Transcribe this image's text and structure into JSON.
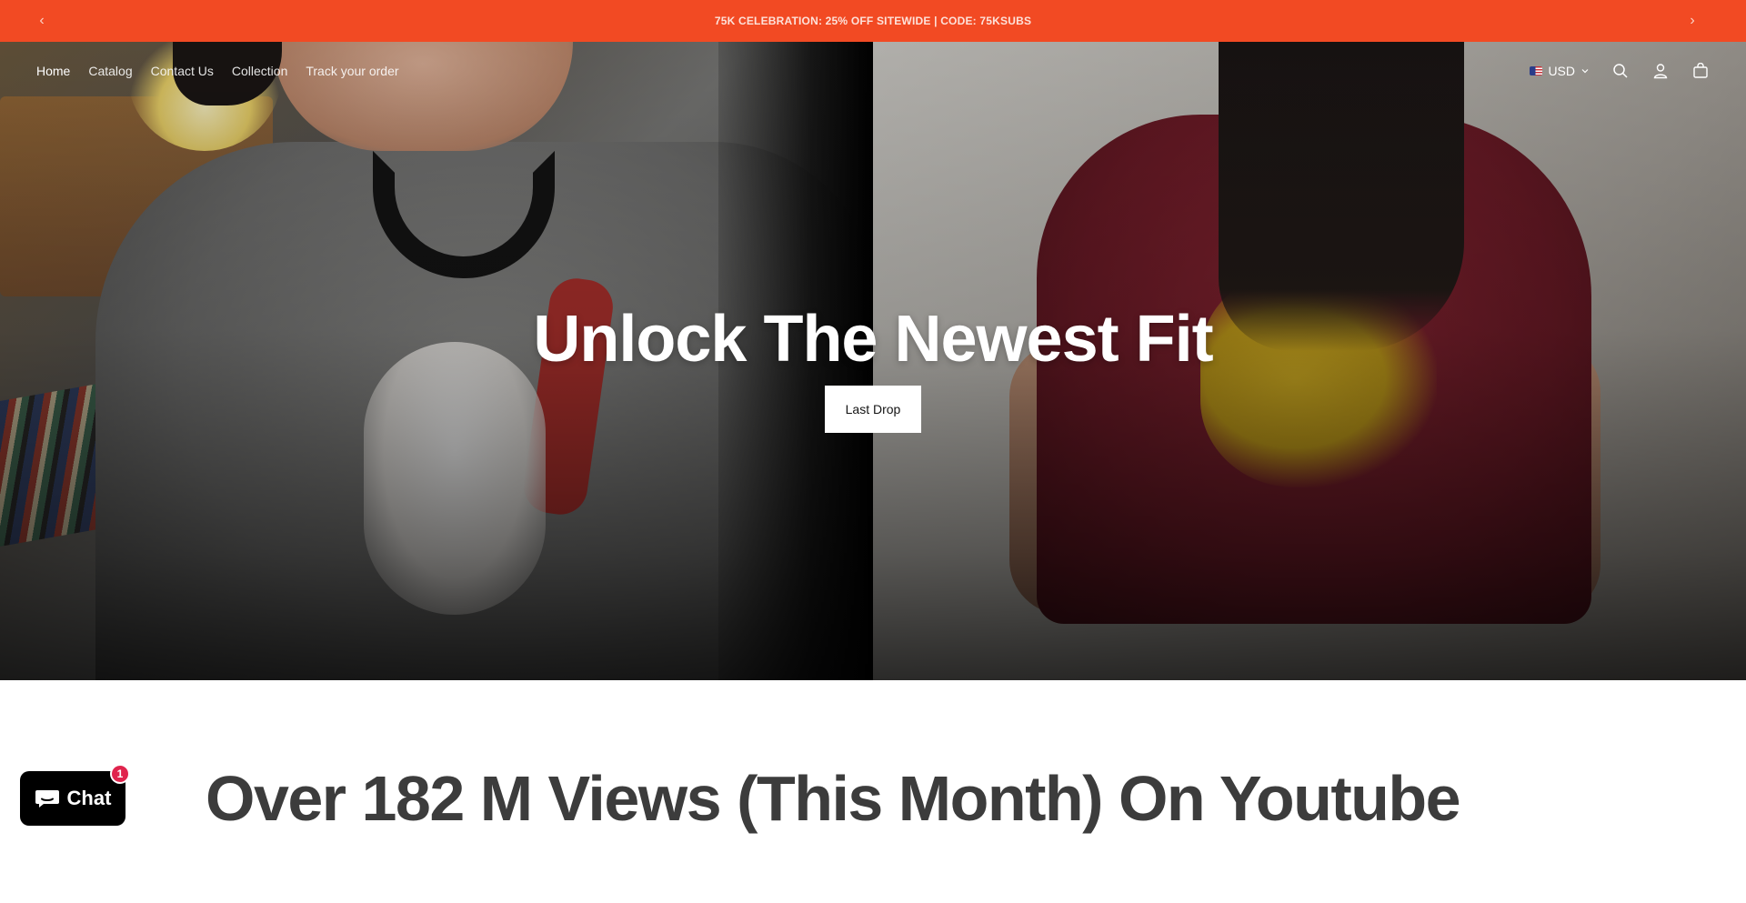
{
  "announcement": {
    "message": "75K CELEBRATION: 25% OFF SITEWIDE | CODE: 75KSUBS",
    "prev_icon": "‹",
    "next_icon": "›"
  },
  "nav": {
    "items": [
      {
        "label": "Home"
      },
      {
        "label": "Catalog"
      },
      {
        "label": "Contact Us"
      },
      {
        "label": "Collection"
      },
      {
        "label": "Track your order"
      }
    ],
    "active_index": 0
  },
  "header_tools": {
    "currency": "USD",
    "currency_flag": "us-flag",
    "icons": [
      "search-icon",
      "account-icon",
      "cart-icon"
    ]
  },
  "hero": {
    "title": "Unlock The Newest Fit",
    "button_label": "Last Drop"
  },
  "section": {
    "title": "Over 182 M Views (This Month) On Youtube"
  },
  "chat": {
    "label": "Chat",
    "badge_count": "1"
  },
  "colors": {
    "announcement_bg": "#f24a23",
    "chat_bg": "#000000",
    "badge": "#e0244d",
    "section_title": "#3c3c3c"
  }
}
